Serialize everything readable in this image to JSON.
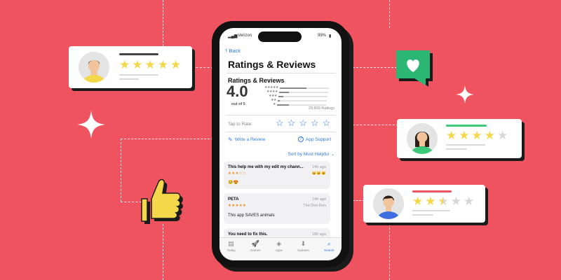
{
  "status_bar": {
    "carrier": "Verizon",
    "battery": "99%"
  },
  "nav": {
    "back": "Back",
    "title": "Ratings & Reviews"
  },
  "ratings": {
    "section_title": "Ratings & Reviews",
    "average": "4.0",
    "out_of": "out of 5",
    "count": "29,809 Ratings",
    "distribution": [
      0.55,
      0.2,
      0.1,
      0.05,
      0.25
    ]
  },
  "tap_to_rate": {
    "label": "Tap to Rate:",
    "stars": [
      "☆",
      "☆",
      "☆",
      "☆",
      "☆"
    ]
  },
  "actions": {
    "write_review": "Write a Review",
    "app_support": "App Support"
  },
  "sort": {
    "label": "Sort by Most Helpful"
  },
  "reviews": [
    {
      "title": "This help me with my edit my chann...",
      "date": "14h ago",
      "stars": "★★★☆☆",
      "author": "",
      "body": "🥺😍"
    },
    {
      "title": "PETA",
      "date": "14h ago",
      "stars": "★★★★★",
      "author": "The Don Ron",
      "body": "This app SAVES animals"
    },
    {
      "title": "You need to fix this.",
      "date": "18h ago",
      "stars": "",
      "author": "",
      "body": ""
    }
  ],
  "tabs": [
    {
      "label": "Today",
      "icon": "▤"
    },
    {
      "label": "Games",
      "icon": "🚀"
    },
    {
      "label": "Apps",
      "icon": "◈"
    },
    {
      "label": "Updates",
      "icon": "⬇"
    },
    {
      "label": "Search",
      "icon": "⌕",
      "active": true
    }
  ],
  "deco_cards": [
    {
      "stars_on": 5,
      "stars_total": 5,
      "accent": "#444444"
    },
    {
      "stars_on": 4,
      "stars_total": 5,
      "accent": "#3cc97a"
    },
    {
      "stars_on": 2.5,
      "stars_total": 5,
      "accent": "#ef5360"
    }
  ],
  "colors": {
    "background": "#ef5360",
    "accent_blue": "#2f7ae5",
    "heart_badge": "#2bb673",
    "thumb": "#f5d84a"
  }
}
